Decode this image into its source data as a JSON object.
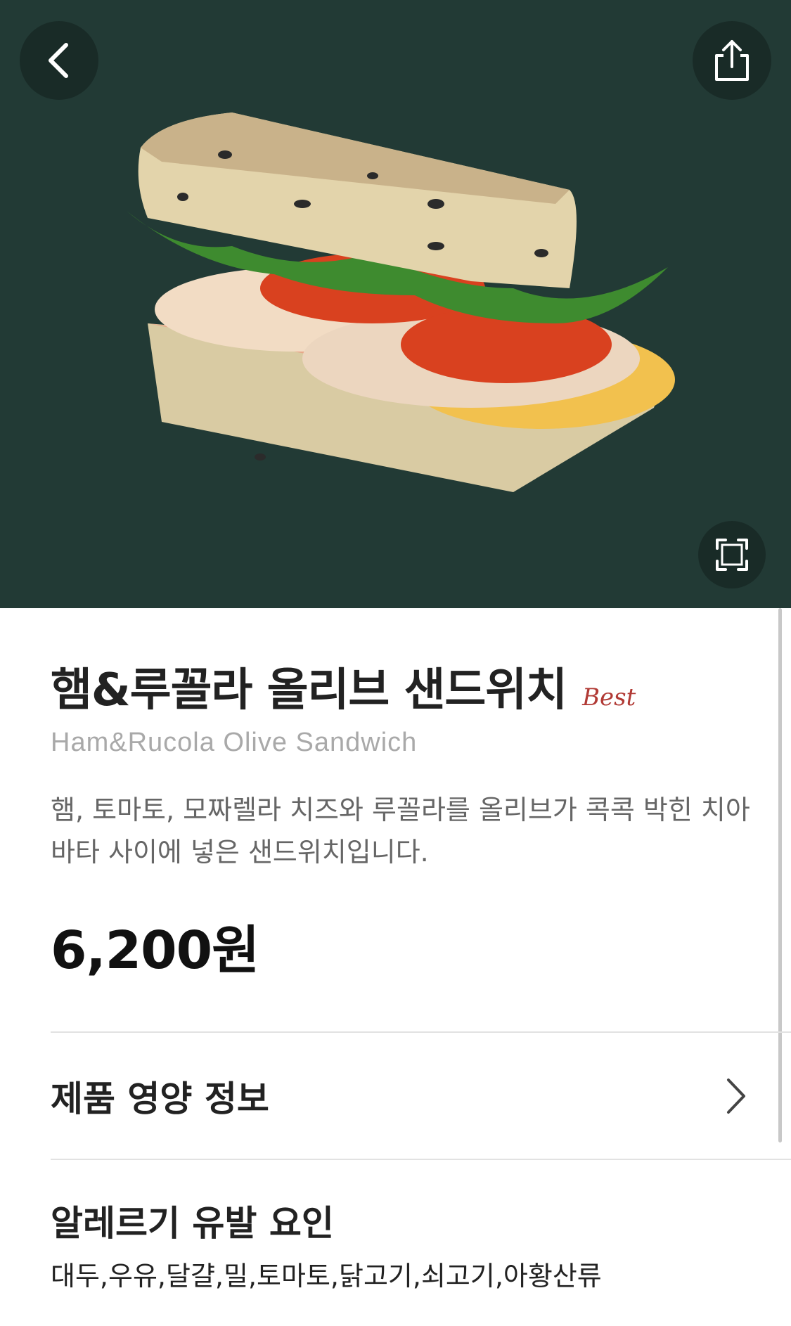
{
  "header": {
    "back_icon": "chevron-left-icon",
    "share_icon": "share-icon",
    "expand_icon": "expand-icon",
    "hero_bg": "#223a35"
  },
  "product": {
    "name_ko": "햄&루꼴라 올리브 샌드위치",
    "badge": "Best",
    "name_en": "Ham&Rucola Olive Sandwich",
    "description": "햄, 토마토, 모짜렐라 치즈와 루꼴라를 올리브가 콕콕 박힌 치아바타 사이에 넣은 샌드위치입니다.",
    "price": "6,200원"
  },
  "sections": {
    "nutrition_label": "제품 영양 정보",
    "allergy_title": "알레르기 유발 요인",
    "allergy_values": "대두,우유,달걀,밀,토마토,닭고기,쇠고기,아황산류"
  },
  "colors": {
    "badge": "#b13a35",
    "subtitle": "#a9a9a9"
  }
}
